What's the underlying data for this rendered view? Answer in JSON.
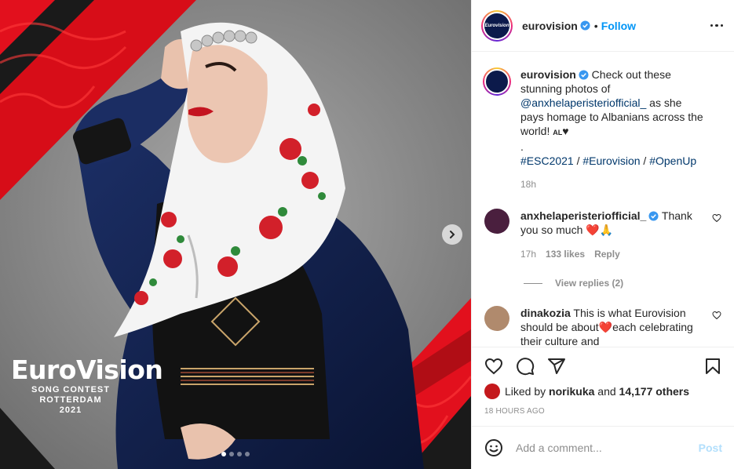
{
  "colors": {
    "link_blue": "#0095f6",
    "tag_blue": "#00376b",
    "muted": "#8e8e8e",
    "brand_red": "#e2101d",
    "post_disabled": "#b2dffc"
  },
  "media": {
    "logo_text": "EuroVision",
    "logo_line1": "SONG CONTEST",
    "logo_line2": "ROTTERDAM 2021",
    "carousel": {
      "count": 4,
      "active": 1
    },
    "next_icon": "chevron-right-icon"
  },
  "header": {
    "avatar_text": "Eurovision",
    "username": "eurovision",
    "verified_icon": "verified-badge-icon",
    "dot": "•",
    "follow": "Follow",
    "more_icon": "more-options-icon"
  },
  "caption": {
    "username": "eurovision",
    "text_before": " Check out these stunning photos of ",
    "mention": "@anxhelaperisteriofficial_",
    "text_after": " as she pays homage to Albanians across the world! ",
    "flag": "AL",
    "heart": "♥",
    "period": ".",
    "hashtag1": "#ESC2021",
    "sep1": " / ",
    "hashtag2": "#Eurovision",
    "sep2": " / ",
    "hashtag3": "#OpenUp",
    "time": "18h"
  },
  "comments": [
    {
      "username": "anxhelaperisteriofficial_",
      "text": " Thank you so much ",
      "emoji": "❤️🙏",
      "time": "17h",
      "likes": "133 likes",
      "reply": "Reply",
      "view_replies": "View replies (2)"
    },
    {
      "username": "dinakozia",
      "text": " This is what Eurovision should be about",
      "emoji": "❤️",
      "text2": "each celebrating their culture and"
    }
  ],
  "actions": {
    "like_icon": "heart-outline-icon",
    "comment_icon": "comment-bubble-icon",
    "share_icon": "paper-plane-share-icon",
    "save_icon": "bookmark-icon"
  },
  "likes": {
    "prefix": "Liked by ",
    "user": "norikuka",
    "middle": " and ",
    "count": "14,177 others"
  },
  "timestamp": "18 HOURS AGO",
  "add_comment": {
    "emoji_icon": "smiley-face-icon",
    "placeholder": "Add a comment...",
    "post": "Post"
  }
}
